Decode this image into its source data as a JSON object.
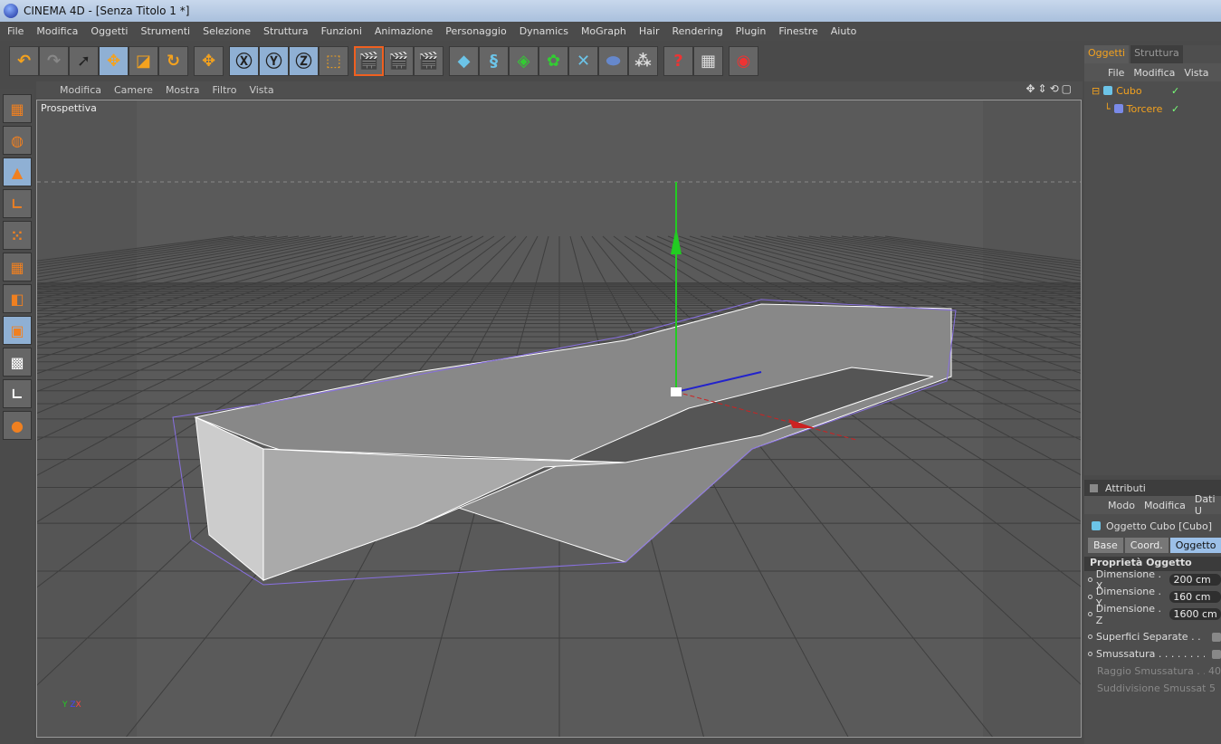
{
  "window": {
    "title": "CINEMA 4D - [Senza Titolo 1 *]"
  },
  "menu": [
    "File",
    "Modifica",
    "Oggetti",
    "Strumenti",
    "Selezione",
    "Struttura",
    "Funzioni",
    "Animazione",
    "Personaggio",
    "Dynamics",
    "MoGraph",
    "Hair",
    "Rendering",
    "Plugin",
    "Finestre",
    "Aiuto"
  ],
  "viewport": {
    "menu": [
      "Modifica",
      "Camere",
      "Mostra",
      "Filtro",
      "Vista"
    ],
    "label": "Prospettiva",
    "axis": {
      "y": "Y",
      "x": "X",
      "z": "Z"
    }
  },
  "objects_panel": {
    "tabs": [
      "Oggetti",
      "Struttura"
    ],
    "menu": [
      "File",
      "Modifica",
      "Vista"
    ],
    "items": [
      {
        "name": "Cubo"
      },
      {
        "name": "Torcere"
      }
    ]
  },
  "attributes": {
    "header": "Attributi",
    "menu": [
      "Modo",
      "Modifica",
      "Dati U"
    ],
    "object_title": "Oggetto Cubo [Cubo]",
    "tabs": [
      "Base",
      "Coord.",
      "Oggetto"
    ],
    "section": "Proprietà Oggetto",
    "fields": [
      {
        "label": "Dimensione . X",
        "value": "200 cm"
      },
      {
        "label": "Dimensione . Y",
        "value": "160 cm"
      },
      {
        "label": "Dimensione . Z",
        "value": "1600 cm"
      }
    ],
    "checks": [
      {
        "label": "Superfici Separate . . . . ."
      },
      {
        "label": "Smussatura . . . . . . . . . ."
      }
    ],
    "disabled": [
      {
        "label": "Raggio Smussatura . . . .",
        "value": "40"
      },
      {
        "label": "Suddivisione Smussatura",
        "value": "5"
      }
    ]
  },
  "colors": {
    "accent": "#f4a21e",
    "selected_tool": "#8fb0d4",
    "viewport_bg": "#5a5a5a"
  }
}
